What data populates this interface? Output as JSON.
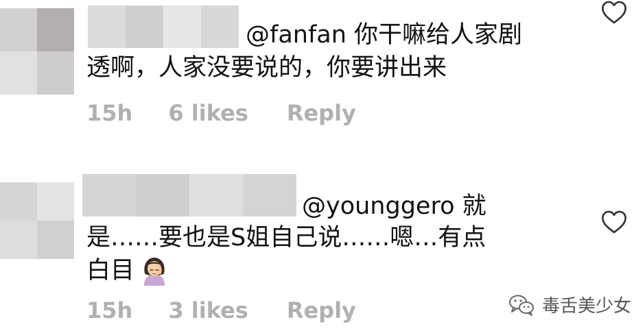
{
  "comments": [
    {
      "mention": "@fanfan",
      "text_line1_rest": " 你干嘛给人家剧",
      "text_line2": "透啊，人家没要说的，你要讲出来",
      "time": "15h",
      "likes": "6 likes",
      "reply_label": "Reply",
      "avatar_colors": [
        "#d3d0d0",
        "#b5aeae",
        "#e2e0e0",
        "#cfcccc"
      ],
      "name_colors": [
        "#dcdcdc",
        "#cfcfcf",
        "#e6e6e6",
        "#d8d8d8"
      ]
    },
    {
      "mention": "@younggero",
      "text_line1_rest": " 就",
      "text_line2": "是……要也是S姐自己说……嗯…有点",
      "text_line3": "白目",
      "time": "15h",
      "likes": "3 likes",
      "reply_label": "Reply",
      "avatar_colors": [
        "#d6d6d6",
        "#e4e4e4",
        "#dddddd",
        "#d0d0d0"
      ],
      "name_colors": [
        "#d6d6d6",
        "#cfcfcf",
        "#e0e0e0",
        "#d4d4d4"
      ]
    }
  ],
  "icons": {
    "heart": "heart-outline-icon",
    "emoji": "face-palm-woman-emoji",
    "wechat": "wechat-icon"
  },
  "watermark": {
    "text": "毒舌美少女"
  }
}
